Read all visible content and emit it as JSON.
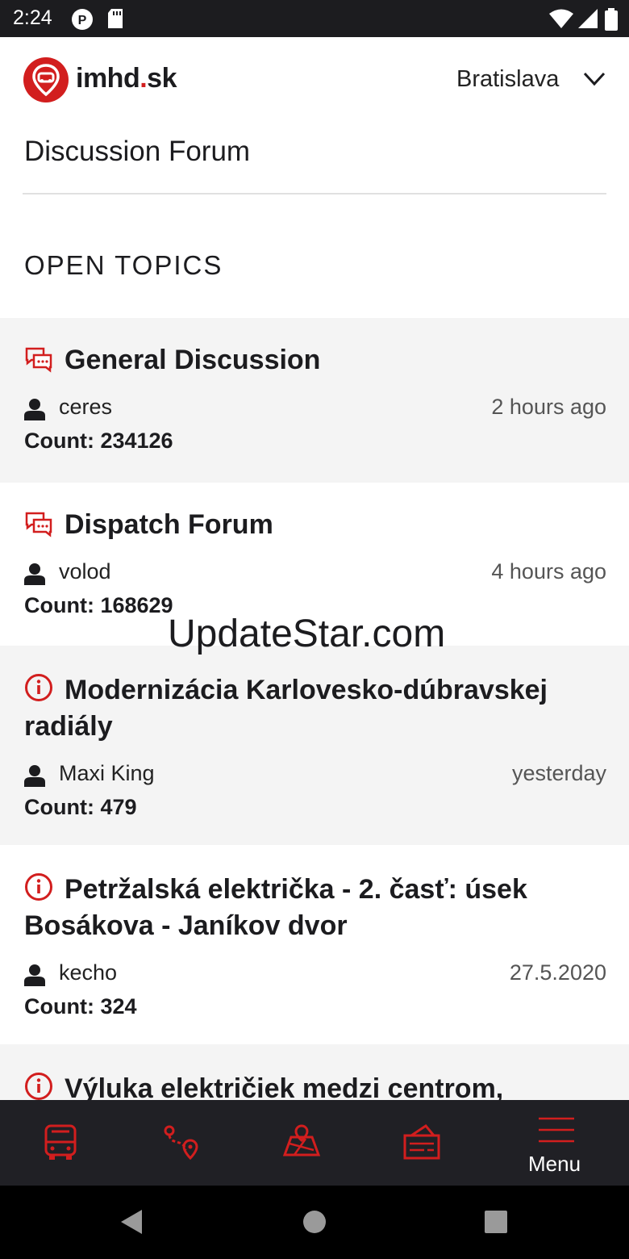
{
  "status_bar": {
    "time": "2:24"
  },
  "header": {
    "brand_main": "imhd",
    "brand_dot": ".",
    "brand_tld": "sk",
    "city": "Bratislava"
  },
  "page": {
    "title": "Discussion Forum",
    "section": "OPEN TOPICS"
  },
  "topics": [
    {
      "icon": "chat-icon",
      "title": "General Discussion",
      "author": "ceres",
      "time": "2 hours ago",
      "count": "Count: 234126"
    },
    {
      "icon": "chat-icon",
      "title": "Dispatch Forum",
      "author": "volod",
      "time": "4 hours ago",
      "count": "Count: 168629"
    },
    {
      "icon": "info-icon",
      "title": "Modernizácia Karlovesko-dúbravskej radiály",
      "author": "Maxi King",
      "time": "yesterday",
      "count": "Count: 479"
    },
    {
      "icon": "info-icon",
      "title": "Petržalská električka - 2. časť: úsek Bosákova - Janíkov dvor",
      "author": "kecho",
      "time": "27.5.2020",
      "count": "Count: 324"
    },
    {
      "icon": "info-icon",
      "title": "Výluka električiek medzi centrom,"
    }
  ],
  "watermark": "UpdateStar.com",
  "bottom_nav": {
    "menu_label": "Menu"
  },
  "colors": {
    "accent": "#d21e1e",
    "nav_bg": "#202025",
    "shaded_bg": "#f4f4f4"
  }
}
